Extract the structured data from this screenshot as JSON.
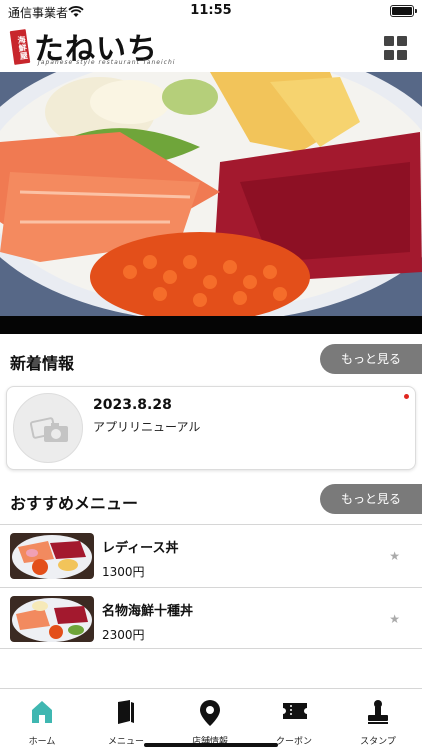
{
  "status_bar": {
    "carrier": "通信事業者",
    "time": "11:55"
  },
  "header": {
    "logo_seal": "海鮮屋",
    "logo_name": "たねいち",
    "logo_sub": "Japanese style restaurant Taneichi",
    "icon": "grid-icon"
  },
  "news": {
    "title": "新着情報",
    "more_label": "もっと見る",
    "items": [
      {
        "date": "2023.8.28",
        "text": "アプリリニューアル",
        "icon": "photo-placeholder-icon",
        "unread_color": "#e0261f"
      }
    ]
  },
  "recommended": {
    "title": "おすすめメニュー",
    "more_label": "もっと見る",
    "items": [
      {
        "name": "レディース丼",
        "price": "1300円",
        "icon": "star-icon"
      },
      {
        "name": "名物海鮮十種丼",
        "price": "2300円",
        "icon": "star-icon"
      }
    ]
  },
  "tabbar": {
    "accent": "#3fb7b1",
    "tabs": [
      {
        "label": "ホーム",
        "icon": "home-icon",
        "active": true
      },
      {
        "label": "メニュー",
        "icon": "book-icon",
        "active": false
      },
      {
        "label": "店舗情報",
        "icon": "location-pin-icon",
        "active": false
      },
      {
        "label": "クーポン",
        "icon": "ticket-icon",
        "active": false
      },
      {
        "label": "スタンプ",
        "icon": "stamp-icon",
        "active": false
      }
    ]
  }
}
